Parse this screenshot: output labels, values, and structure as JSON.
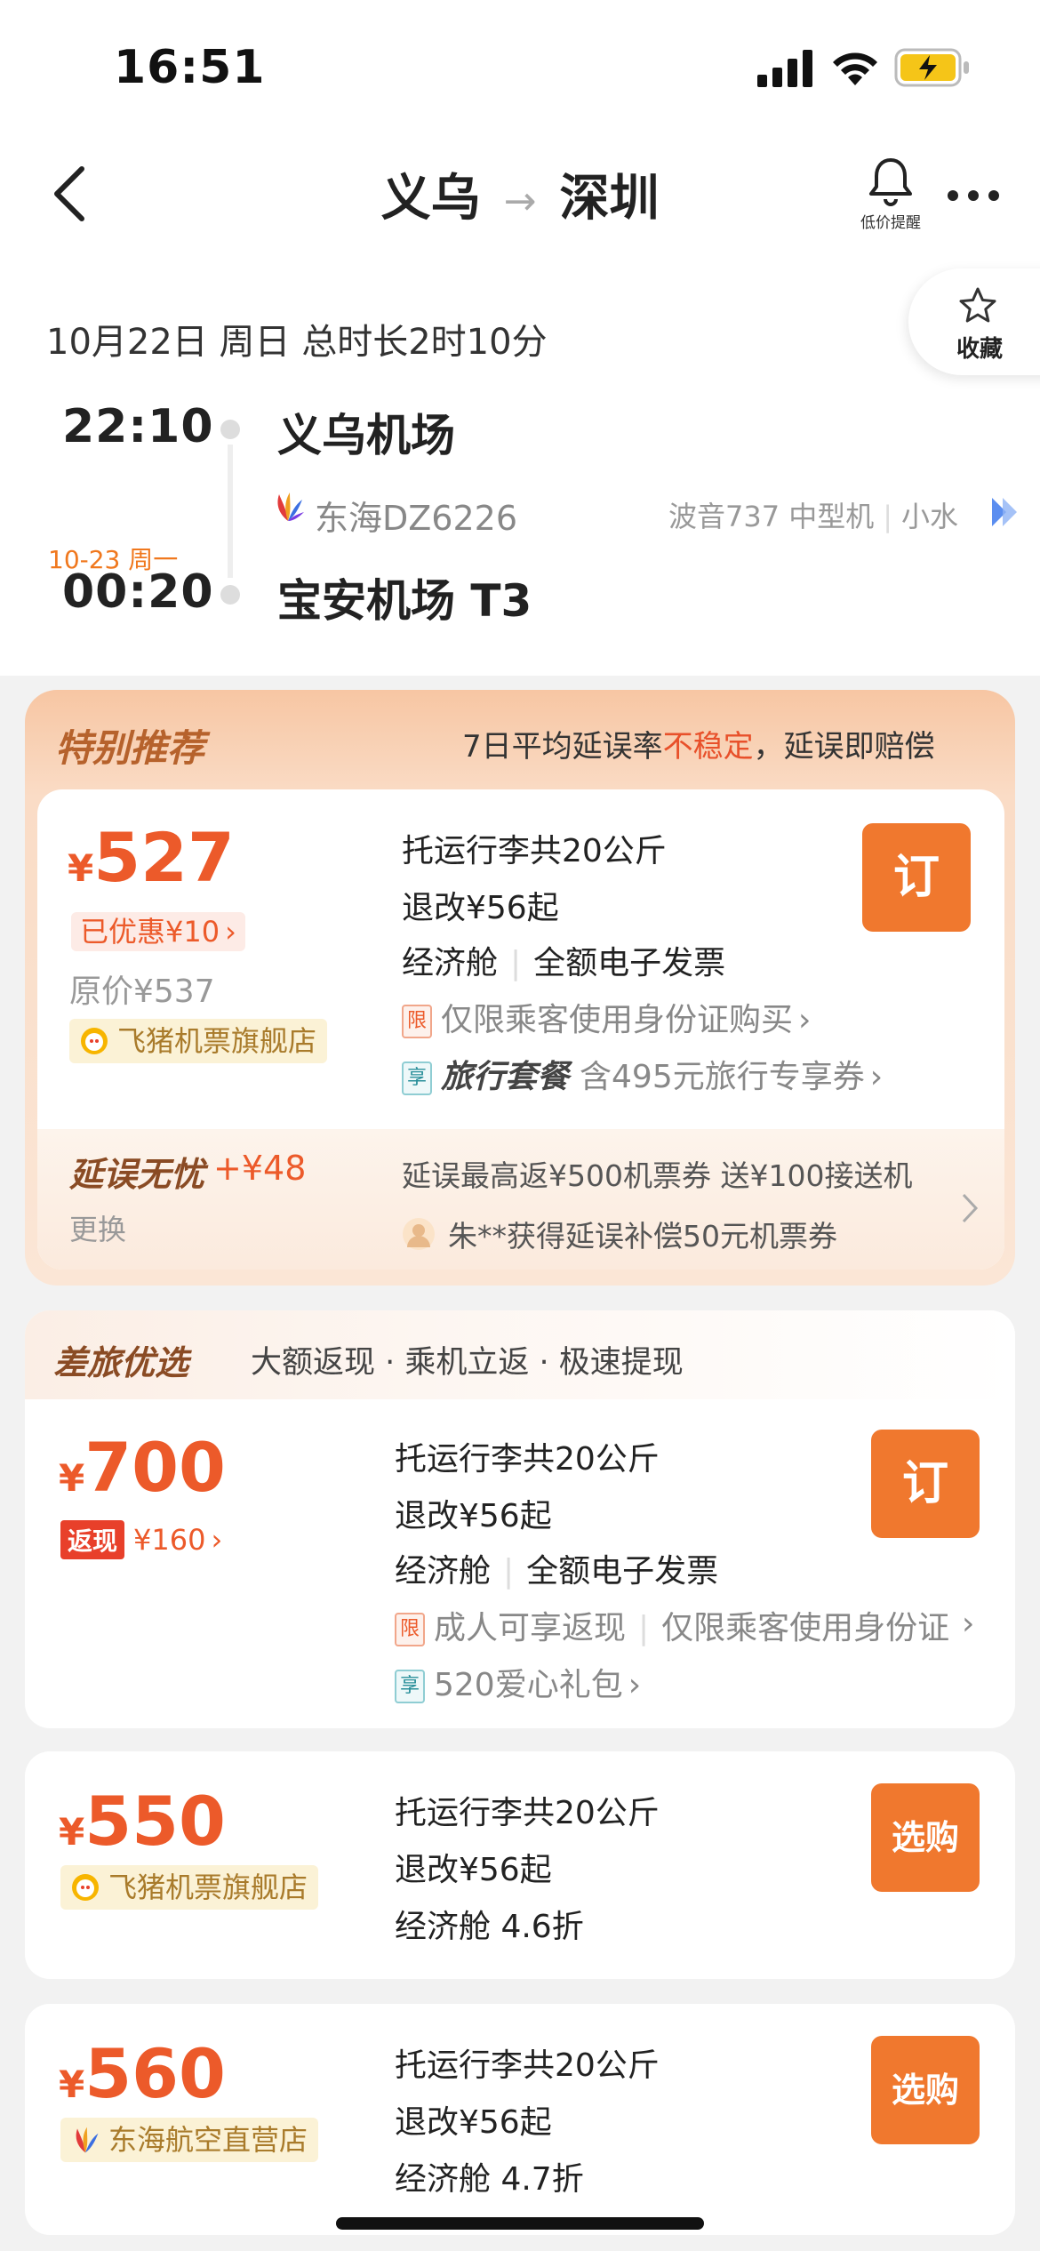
{
  "status_bar": {
    "time": "16:51"
  },
  "header": {
    "origin": "义乌",
    "arrow": "→",
    "destination": "深圳",
    "alert_label": "低价提醒",
    "favorite_label": "收藏"
  },
  "flight": {
    "date_line": "10月22日 周日 总时长2时10分",
    "dep_time": "22:10",
    "dep_airport": "义乌机场",
    "arr_date_note": "10-23 周一",
    "arr_time": "00:20",
    "arr_airport": "宝安机场 T3",
    "airline_flight": "东海DZ6226",
    "aircraft": "波音737 中型机",
    "aircraft_extra": "小水"
  },
  "special": {
    "title": "特别推荐",
    "note_prefix": "7日平均延误率",
    "note_highlight": "不稳定",
    "note_suffix": "，延误即赔偿",
    "yen": "¥",
    "price": "527",
    "discount": "已优惠¥10",
    "original_price": "原价¥537",
    "shop": "飞猪机票旗舰店",
    "baggage": "托运行李共20公斤",
    "refund": "退改¥56起",
    "cabin": "经济舱",
    "invoice": "全额电子发票",
    "limit_tag": "限",
    "limit_text": "仅限乘客使用身份证购买",
    "enjoy_tag": "享",
    "package_title": "旅行套餐",
    "package_text": "含495元旅行专享券",
    "order_label": "订",
    "delay_title": "延误无忧",
    "delay_price": "+¥48",
    "delay_change": "更换",
    "delay_desc": "延误最高返¥500机票券   送¥100接送机",
    "delay_user": "朱**获得延误补偿50元机票券"
  },
  "business": {
    "title": "差旅优选",
    "slogan": "大额返现 · 乘机立返 · 极速提现",
    "yen": "¥",
    "price": "700",
    "cash_tag": "返现",
    "cash_amount": "¥160",
    "baggage": "托运行李共20公斤",
    "refund": "退改¥56起",
    "cabin": "经济舱",
    "invoice": "全额电子发票",
    "limit_tag": "限",
    "limit_text_1": "成人可享返现",
    "limit_text_2": "仅限乘客使用身份证",
    "enjoy_tag": "享",
    "gift_text": "520爱心礼包",
    "order_label": "订"
  },
  "offers": [
    {
      "yen": "¥",
      "price": "550",
      "shop": "飞猪机票旗舰店",
      "baggage": "托运行李共20公斤",
      "refund": "退改¥56起",
      "cabin": "经济舱 4.6折",
      "buy_label": "选购"
    },
    {
      "yen": "¥",
      "price": "560",
      "shop": "东海航空直营店",
      "baggage": "托运行李共20公斤",
      "refund": "退改¥56起",
      "cabin": "经济舱 4.7折",
      "buy_label": "选购"
    }
  ],
  "colors": {
    "accent": "#f0782e",
    "price": "#ec5a2a"
  }
}
